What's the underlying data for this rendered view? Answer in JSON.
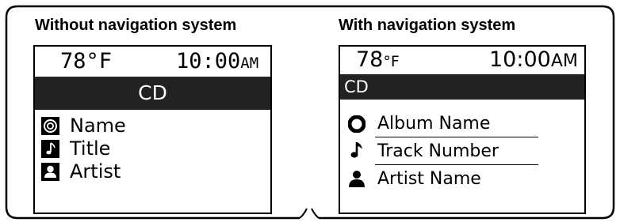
{
  "left_panel": {
    "title": "Without navigation system",
    "screen": {
      "temperature": "78",
      "temperature_unit": "°F",
      "time": "10:00",
      "time_suffix": "AM",
      "source": "CD",
      "items": [
        {
          "label": "Name",
          "icon": "disc-icon"
        },
        {
          "label": "Title",
          "icon": "music-note-icon"
        },
        {
          "label": "Artist",
          "icon": "person-icon"
        }
      ]
    }
  },
  "right_panel": {
    "title": "With navigation system",
    "screen": {
      "temperature": "78",
      "temperature_unit": "°F",
      "time": "10:00",
      "time_suffix": "AM",
      "source": "CD",
      "items": [
        {
          "label": "Album Name",
          "icon": "disc-icon"
        },
        {
          "label": "Track Number",
          "icon": "music-note-icon"
        },
        {
          "label": "Artist Name",
          "icon": "person-icon"
        }
      ]
    }
  }
}
